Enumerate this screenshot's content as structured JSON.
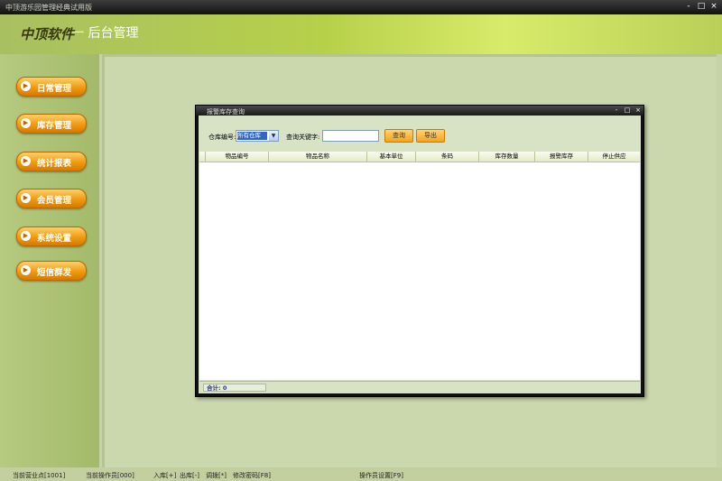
{
  "window": {
    "title": "中顶游乐园管理经典试用版",
    "controls": [
      "-",
      "□",
      "×"
    ]
  },
  "header": {
    "brand": "中顶软件",
    "subtitle": "一 后台管理"
  },
  "sidebar": {
    "items": [
      {
        "label": "日常管理"
      },
      {
        "label": "库存管理"
      },
      {
        "label": "统计报表"
      },
      {
        "label": "会员管理"
      },
      {
        "label": "系统设置"
      },
      {
        "label": "短信群发"
      }
    ]
  },
  "dialog": {
    "title": "报警库存查询",
    "controls": [
      "-",
      "□",
      "×"
    ],
    "warehouse_label": "仓库编号:",
    "warehouse_value": "所有仓库",
    "keyword_label": "查询关键字:",
    "keyword_value": "",
    "query_button": "查询",
    "export_button": "导出",
    "columns": [
      "物品编号",
      "物品名称",
      "基本单位",
      "条码",
      "库存数量",
      "报警库存",
      "停止供应"
    ],
    "total": "合计: 0"
  },
  "status": {
    "point": "当前营业点[1001]",
    "operator": "当前操作员[000]",
    "in": "入库[+]",
    "out": "出库[-]",
    "adjust": "调拨[*]",
    "password": "修改密码[F8]",
    "settings": "操作员设置[F9]"
  }
}
